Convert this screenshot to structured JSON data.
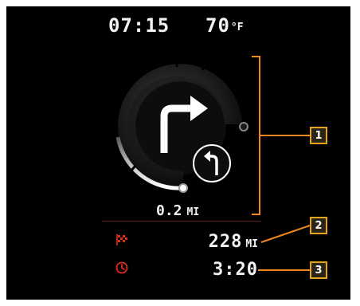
{
  "status_bar": {
    "time": "07:15",
    "temperature": "70",
    "temperature_unit": "°F"
  },
  "navigation": {
    "primary_turn": "turn-right-arrow-icon",
    "secondary_turn": "turn-left-arrow-icon",
    "distance_value": "0.2",
    "distance_unit": "MI"
  },
  "trip": {
    "distance_value": "228",
    "distance_unit": "MI",
    "distance_icon": "checkered-flag-icon",
    "time_value": "3:20",
    "time_icon": "clock-icon"
  },
  "callouts": [
    "1",
    "2",
    "3"
  ],
  "colors": {
    "screen_bg": "#000000",
    "text": "#f2f2f2",
    "trip_icon": "#e02d1b",
    "callout_line": "#f08a1c",
    "callout_badge_border": "#e8a418"
  }
}
